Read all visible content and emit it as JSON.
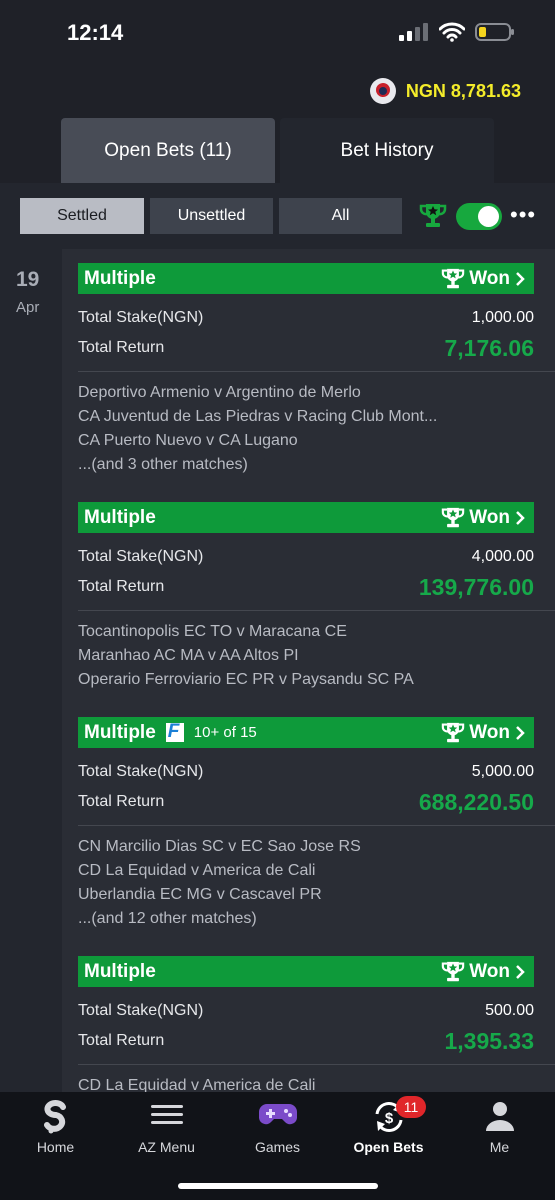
{
  "status": {
    "time": "12:14"
  },
  "header": {
    "balance": "NGN 8,781.63",
    "tabs": [
      {
        "label": "Open Bets (11)"
      },
      {
        "label": "Bet History"
      }
    ]
  },
  "filters": {
    "segments": [
      {
        "label": "Settled"
      },
      {
        "label": "Unsettled"
      },
      {
        "label": "All"
      }
    ],
    "toggle_on": true
  },
  "date": {
    "day": "19",
    "month": "Apr"
  },
  "bets": [
    {
      "type": "Multiple",
      "status": "Won",
      "stake_label": "Total Stake(NGN)",
      "stake": "1,000.00",
      "return_label": "Total Return",
      "return": "7,176.06",
      "matches": [
        "Deportivo Armenio v Argentino de Merlo",
        "CA Juventud de Las Piedras v Racing Club Mont...",
        "CA Puerto Nuevo v CA Lugano",
        "...(and 3 other matches)"
      ]
    },
    {
      "type": "Multiple",
      "status": "Won",
      "stake_label": "Total Stake(NGN)",
      "stake": "4,000.00",
      "return_label": "Total Return",
      "return": "139,776.00",
      "matches": [
        "Tocantinopolis EC TO v Maracana CE",
        "Maranhao AC MA v AA Altos PI",
        "Operario Ferroviario EC PR v Paysandu SC PA"
      ]
    },
    {
      "type": "Multiple",
      "status": "Won",
      "badge": "F",
      "extra": "10+ of 15",
      "stake_label": "Total Stake(NGN)",
      "stake": "5,000.00",
      "return_label": "Total Return",
      "return": "688,220.50",
      "matches": [
        "CN Marcilio Dias SC v EC Sao Jose RS",
        "CD La Equidad v America de Cali",
        "Uberlandia EC MG v Cascavel PR",
        "...(and 12 other matches)"
      ]
    },
    {
      "type": "Multiple",
      "status": "Won",
      "stake_label": "Total Stake(NGN)",
      "stake": "500.00",
      "return_label": "Total Return",
      "return": "1,395.33",
      "matches": [
        "CD La Equidad v America de Cali"
      ]
    }
  ],
  "nav": {
    "items": [
      {
        "label": "Home",
        "icon": "s-logo-icon"
      },
      {
        "label": "AZ Menu",
        "icon": "hamburger-icon"
      },
      {
        "label": "Games",
        "icon": "gamepad-icon"
      },
      {
        "label": "Open Bets",
        "icon": "open-bets-icon",
        "badge": "11"
      },
      {
        "label": "Me",
        "icon": "person-icon"
      }
    ]
  },
  "colors": {
    "won_green": "#0e9a3a",
    "return_green": "#16a94a",
    "balance_yellow": "#f4ec2a",
    "badge_red": "#e0262a"
  }
}
